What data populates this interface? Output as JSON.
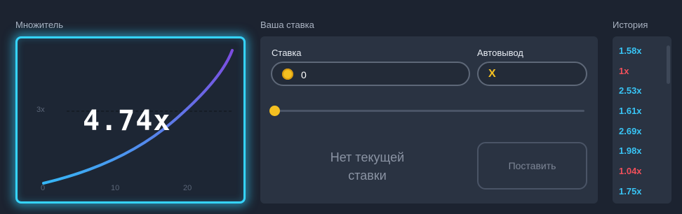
{
  "multiplier": {
    "title": "Множитель",
    "value": "4.74x",
    "y_tick_label": "3x",
    "x_tick_labels": [
      "0",
      "10",
      "20"
    ],
    "curve_color_start": "#35b6f5",
    "curve_color_end": "#7c4ce0",
    "glow_color": "#35d4ff"
  },
  "bet": {
    "title": "Ваша ставка",
    "stake_label": "Ставка",
    "stake_value": "0",
    "autocashout_label": "Автовывод",
    "autocashout_value": "X",
    "no_bet_text_line1": "Нет текущей",
    "no_bet_text_line2": "ставки",
    "place_button": "Поставить",
    "coin_icon": "coin-icon",
    "accent_color": "#f4c021"
  },
  "history": {
    "title": "История",
    "items": [
      {
        "value": "1.58x",
        "color": "#38c4f5"
      },
      {
        "value": "1x",
        "color": "#f0505a"
      },
      {
        "value": "2.53x",
        "color": "#38c4f5"
      },
      {
        "value": "1.61x",
        "color": "#38c4f5"
      },
      {
        "value": "2.69x",
        "color": "#38c4f5"
      },
      {
        "value": "1.98x",
        "color": "#38c4f5"
      },
      {
        "value": "1.04x",
        "color": "#f0505a"
      },
      {
        "value": "1.75x",
        "color": "#38c4f5"
      }
    ]
  }
}
